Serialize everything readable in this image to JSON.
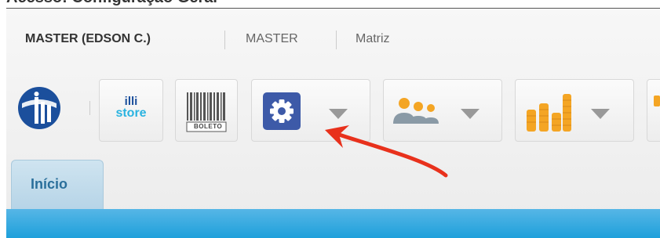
{
  "caption": "Acesso: Configuração Geral",
  "header": {
    "user": "MASTER (EDSON C.)",
    "tenant": "MASTER",
    "branch": "Matriz"
  },
  "toolbar": {
    "store_label_1": "illi",
    "store_label_2": "store",
    "boleto_label": "BOLETO"
  },
  "tabs": [
    {
      "label": "Início"
    }
  ],
  "colors": {
    "accent_blue": "#1ea0db",
    "gear_bg": "#3d5aa8",
    "arrow_red": "#e8311c"
  }
}
